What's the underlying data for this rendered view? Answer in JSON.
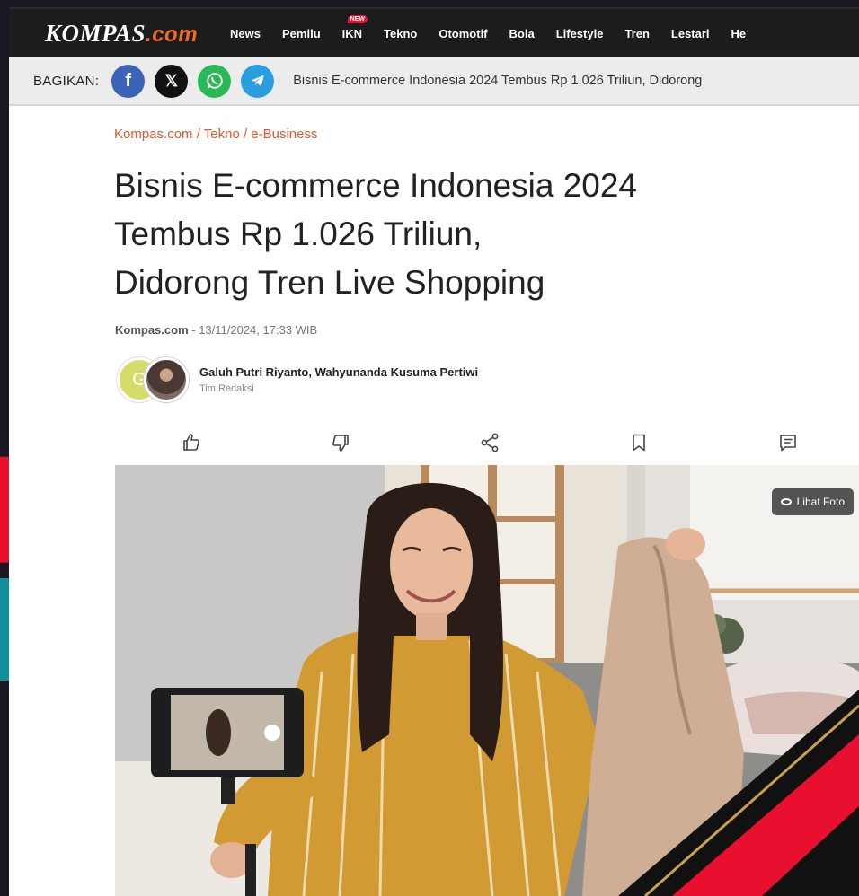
{
  "header": {
    "logo_main": "KOMPAS",
    "logo_suffix": ".com",
    "nav": [
      {
        "label": "News"
      },
      {
        "label": "Pemilu"
      },
      {
        "label": "IKN",
        "badge": "NEW"
      },
      {
        "label": "Tekno"
      },
      {
        "label": "Otomotif"
      },
      {
        "label": "Bola"
      },
      {
        "label": "Lifestyle"
      },
      {
        "label": "Tren"
      },
      {
        "label": "Lestari"
      },
      {
        "label": "He"
      }
    ]
  },
  "share": {
    "label": "BAGIKAN:",
    "icons": {
      "facebook": "f",
      "x": "𝕏"
    },
    "article_title": "Bisnis E-commerce Indonesia 2024 Tembus Rp 1.026 Triliun, Didorong"
  },
  "article": {
    "breadcrumb": "Kompas.com / Tekno / e-Business",
    "headline_lines": [
      "Bisnis E-commerce Indonesia 2024",
      "Tembus Rp 1.026 Triliun,",
      "Didorong Tren Live Shopping"
    ],
    "source": "Kompas.com",
    "datetime": " - 13/11/2024, 17:33 WIB",
    "avatar_initial": "G",
    "authors": "Galuh Putri Riyanto, Wahyunanda Kusuma Pertiwi",
    "role": "Tim Redaksi"
  },
  "photo": {
    "view_button": "Lihat Foto"
  },
  "colors": {
    "accent": "#e0582b",
    "nav_bg": "#1b1c1e",
    "brand_orange": "#f36a23"
  }
}
